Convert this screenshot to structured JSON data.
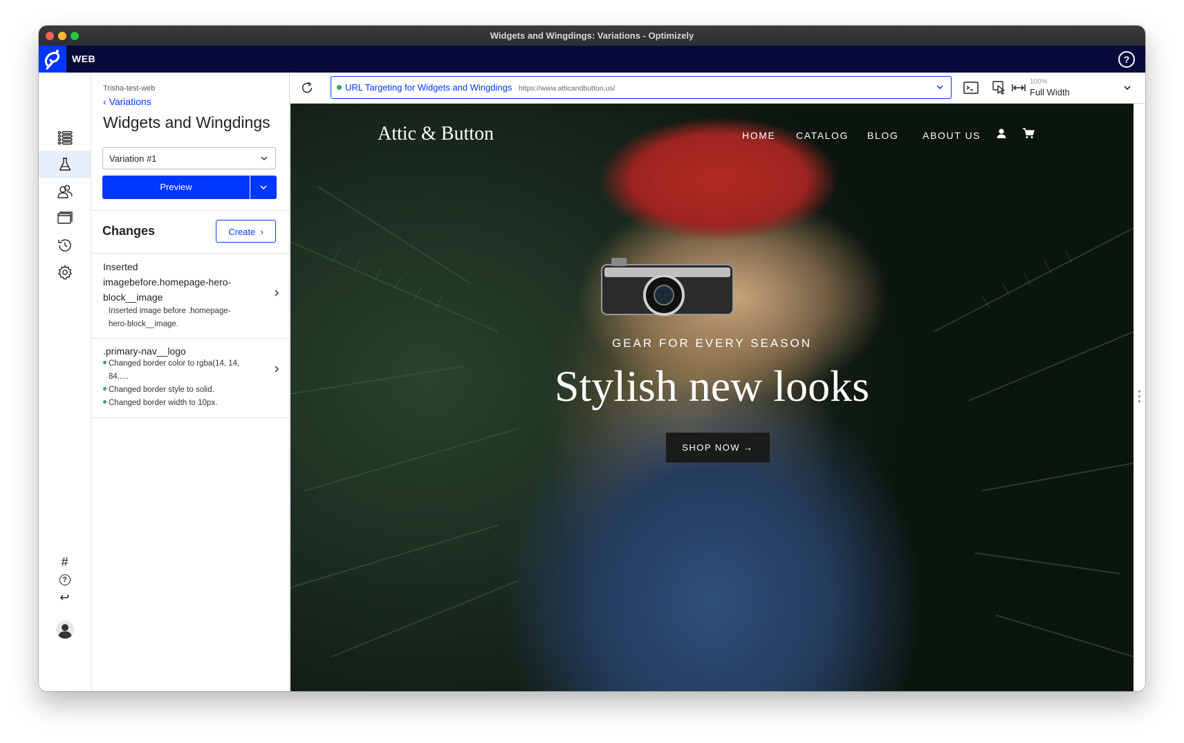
{
  "window": {
    "title": "Widgets and Wingdings: Variations - Optimizely"
  },
  "appbar": {
    "label": "WEB",
    "help_glyph": "?"
  },
  "rail": {
    "icons": [
      "list-icon",
      "flask-icon",
      "users-icon",
      "screens-icon",
      "history-icon",
      "gear-icon",
      "hash-icon",
      "help-icon",
      "return-icon",
      "avatar"
    ],
    "hash_glyph": "#",
    "help_glyph": "?",
    "return_glyph": "↩"
  },
  "panel": {
    "project": "Trisha-test-web",
    "back_label": "Variations",
    "title": "Widgets and Wingdings",
    "variation_selected": "Variation #1",
    "preview_label": "Preview",
    "changes_title": "Changes",
    "create_label": "Create",
    "changes": [
      {
        "title_lines": [
          "Inserted",
          "imagebefore.homepage-hero-",
          "block__image"
        ],
        "detail_lines": [
          "Inserted image before .homepage-",
          "hero-block__image."
        ]
      },
      {
        "title_lines": [
          ".primary-nav__logo"
        ],
        "bullets": [
          "Changed border color to rgba(14, 14,",
          "84,....",
          "Changed border style to solid.",
          "Changed border width to 10px."
        ]
      }
    ]
  },
  "toolbar": {
    "url_label": "URL Targeting for Widgets and Wingdings",
    "url_value": "https://www.atticandbutton.us/",
    "zoom_percent": "100%",
    "zoom_mode": "Full Width"
  },
  "site": {
    "brand": "Attic & Button",
    "nav": [
      "HOME",
      "CATALOG",
      "BLOG",
      "ABOUT US"
    ],
    "hero_kicker": "GEAR FOR EVERY SEASON",
    "hero_title": "Stylish new looks",
    "cta": "SHOP NOW →"
  },
  "colors": {
    "accent": "#0037ff",
    "appbar": "#080a3a",
    "status_ok": "#3aa35c"
  }
}
